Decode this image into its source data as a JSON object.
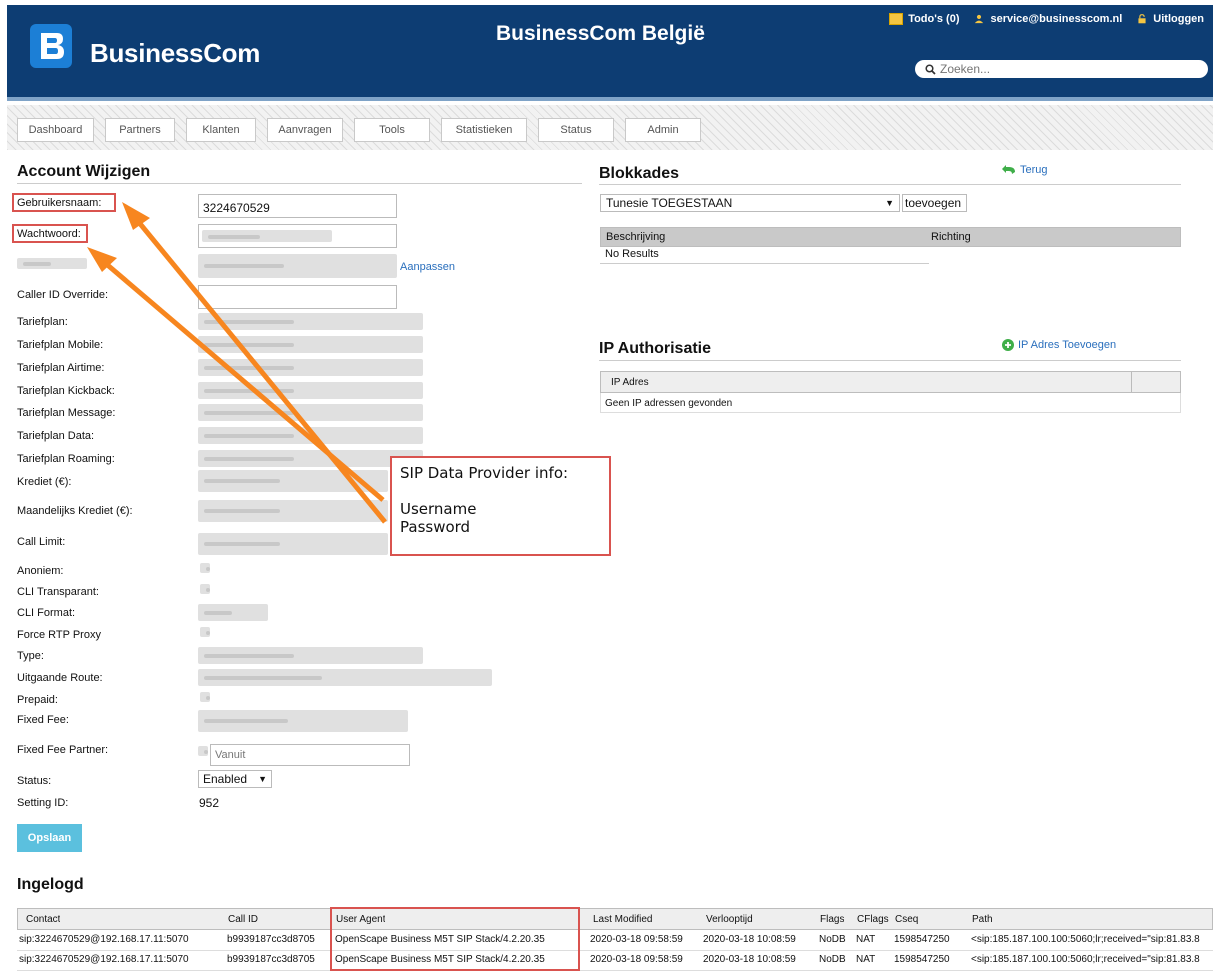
{
  "header": {
    "logo_text": "BusinessCom",
    "site_title": "BusinessCom België",
    "todos_label": "Todo's (0)",
    "user_email": "service@businesscom.nl",
    "logout_label": "Uitloggen",
    "search_placeholder": "Zoeken..."
  },
  "nav": {
    "items": [
      "Dashboard",
      "Partners",
      "Klanten",
      "Aanvragen",
      "Tools",
      "Statistieken",
      "Status",
      "Admin"
    ]
  },
  "account": {
    "title": "Account Wijzigen",
    "labels": {
      "username": "Gebruikersnaam:",
      "password": "Wachtwoord:",
      "caller_id": "Caller ID Override:",
      "tariefplan": "Tariefplan:",
      "tariefplan_mobile": "Tariefplan Mobile:",
      "tariefplan_airtime": "Tariefplan Airtime:",
      "tariefplan_kickback": "Tariefplan Kickback:",
      "tariefplan_message": "Tariefplan Message:",
      "tariefplan_data": "Tariefplan Data:",
      "tariefplan_roaming": "Tariefplan Roaming:",
      "krediet": "Krediet (€):",
      "maandelijks_krediet": "Maandelijks Krediet (€):",
      "call_limit": "Call Limit:",
      "anoniem": "Anoniem:",
      "cli_transparant": "CLI Transparant:",
      "cli_format": "CLI Format:",
      "force_rtp": "Force RTP Proxy",
      "type": "Type:",
      "uitgaande_route": "Uitgaande Route:",
      "prepaid": "Prepaid:",
      "fixed_fee": "Fixed Fee:",
      "fixed_fee_partner": "Fixed Fee Partner:",
      "status": "Status:",
      "setting_id": "Setting ID:"
    },
    "username_value": "3224670529",
    "aanpassen_link": "Aanpassen",
    "fixed_fee_partner_value": "Vanuit",
    "status_value": "Enabled",
    "setting_id_value": "952",
    "save_label": "Opslaan"
  },
  "blokkades": {
    "title": "Blokkades",
    "back_link": "Terug",
    "select_value": "Tunesie TOEGESTAAN",
    "add_button": "toevoegen",
    "headers": [
      "Beschrijving",
      "Richting"
    ],
    "empty": "No Results"
  },
  "ip": {
    "title": "IP Authorisatie",
    "add_link": "IP Adres Toevoegen",
    "header": "IP Adres",
    "empty": "Geen IP adressen gevonden"
  },
  "annotation": {
    "line1": "SIP Data Provider info:",
    "line2": "Username",
    "line3": "Password"
  },
  "ingelogd": {
    "title": "Ingelogd",
    "headers": [
      "Contact",
      "Call ID",
      "User Agent",
      "Last Modified",
      "Verlooptijd",
      "Flags",
      "CFlags",
      "Cseq",
      "Path"
    ],
    "rows": [
      [
        "sip:3224670529@192.168.17.11:5070",
        "b9939187cc3d8705",
        "OpenScape Business M5T SIP Stack/4.2.20.35",
        "2020-03-18 09:58:59",
        "2020-03-18 10:08:59",
        "NoDB",
        "NAT",
        "1598547250",
        "<sip:185.187.100.100:5060;lr;received=\"sip:81.83.8"
      ],
      [
        "sip:3224670529@192.168.17.11:5070",
        "b9939187cc3d8705",
        "OpenScape Business M5T SIP Stack/4.2.20.35",
        "2020-03-18 09:58:59",
        "2020-03-18 10:08:59",
        "NoDB",
        "NAT",
        "1598547250",
        "<sip:185.187.100.100:5060;lr;received=\"sip:81.83.8"
      ]
    ]
  },
  "colors": {
    "header_bg": "#0d3d73",
    "logo_blue": "#1c7fd6",
    "link_blue": "#2a6fbd",
    "annotation_red": "#d9534f",
    "arrow_orange": "#f7861f",
    "save_button": "#5bc0de"
  }
}
